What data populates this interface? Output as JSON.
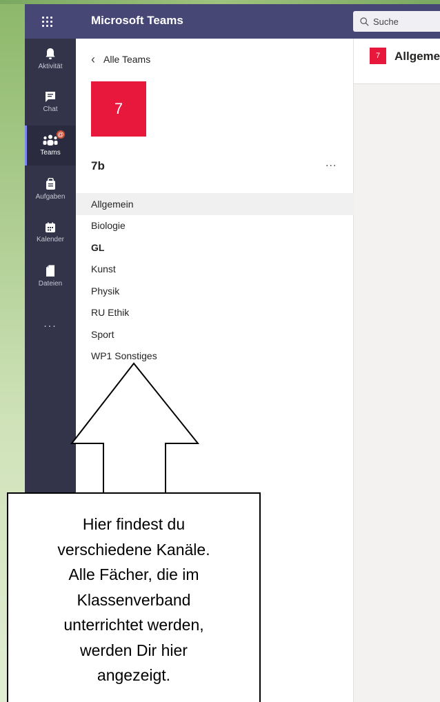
{
  "header": {
    "app_title": "Microsoft Teams",
    "search_placeholder": "Suche"
  },
  "rail": {
    "items": [
      {
        "label": "Aktivität",
        "icon": "bell-icon"
      },
      {
        "label": "Chat",
        "icon": "chat-icon"
      },
      {
        "label": "Teams",
        "icon": "teams-icon",
        "badge": "@",
        "active": true
      },
      {
        "label": "Aufgaben",
        "icon": "assignments-icon"
      },
      {
        "label": "Kalender",
        "icon": "calendar-icon"
      },
      {
        "label": "Dateien",
        "icon": "files-icon"
      }
    ],
    "more": "..."
  },
  "panel": {
    "back_label": "Alle Teams",
    "team_tile": "7",
    "team_name": "7b",
    "more": "...",
    "channels": [
      {
        "name": "Allgemein",
        "selected": true
      },
      {
        "name": "Biologie"
      },
      {
        "name": "GL",
        "bold": true
      },
      {
        "name": "Kunst"
      },
      {
        "name": "Physik"
      },
      {
        "name": "RU Ethik"
      },
      {
        "name": "Sport"
      },
      {
        "name": "WP1 Sonstiges"
      }
    ]
  },
  "main": {
    "tile": "7",
    "title": "Allgemein"
  },
  "annotation": {
    "lines": [
      "Hier findest du",
      "verschiedene Kanäle.",
      "Alle Fächer, die im",
      "Klassenverband",
      "unterrichtet werden,",
      "werden Dir hier",
      "angezeigt."
    ]
  },
  "colors": {
    "header": "#464775",
    "rail": "#33344a",
    "team_tile": "#e8173c",
    "rail_active_indicator": "#7f85f5"
  }
}
